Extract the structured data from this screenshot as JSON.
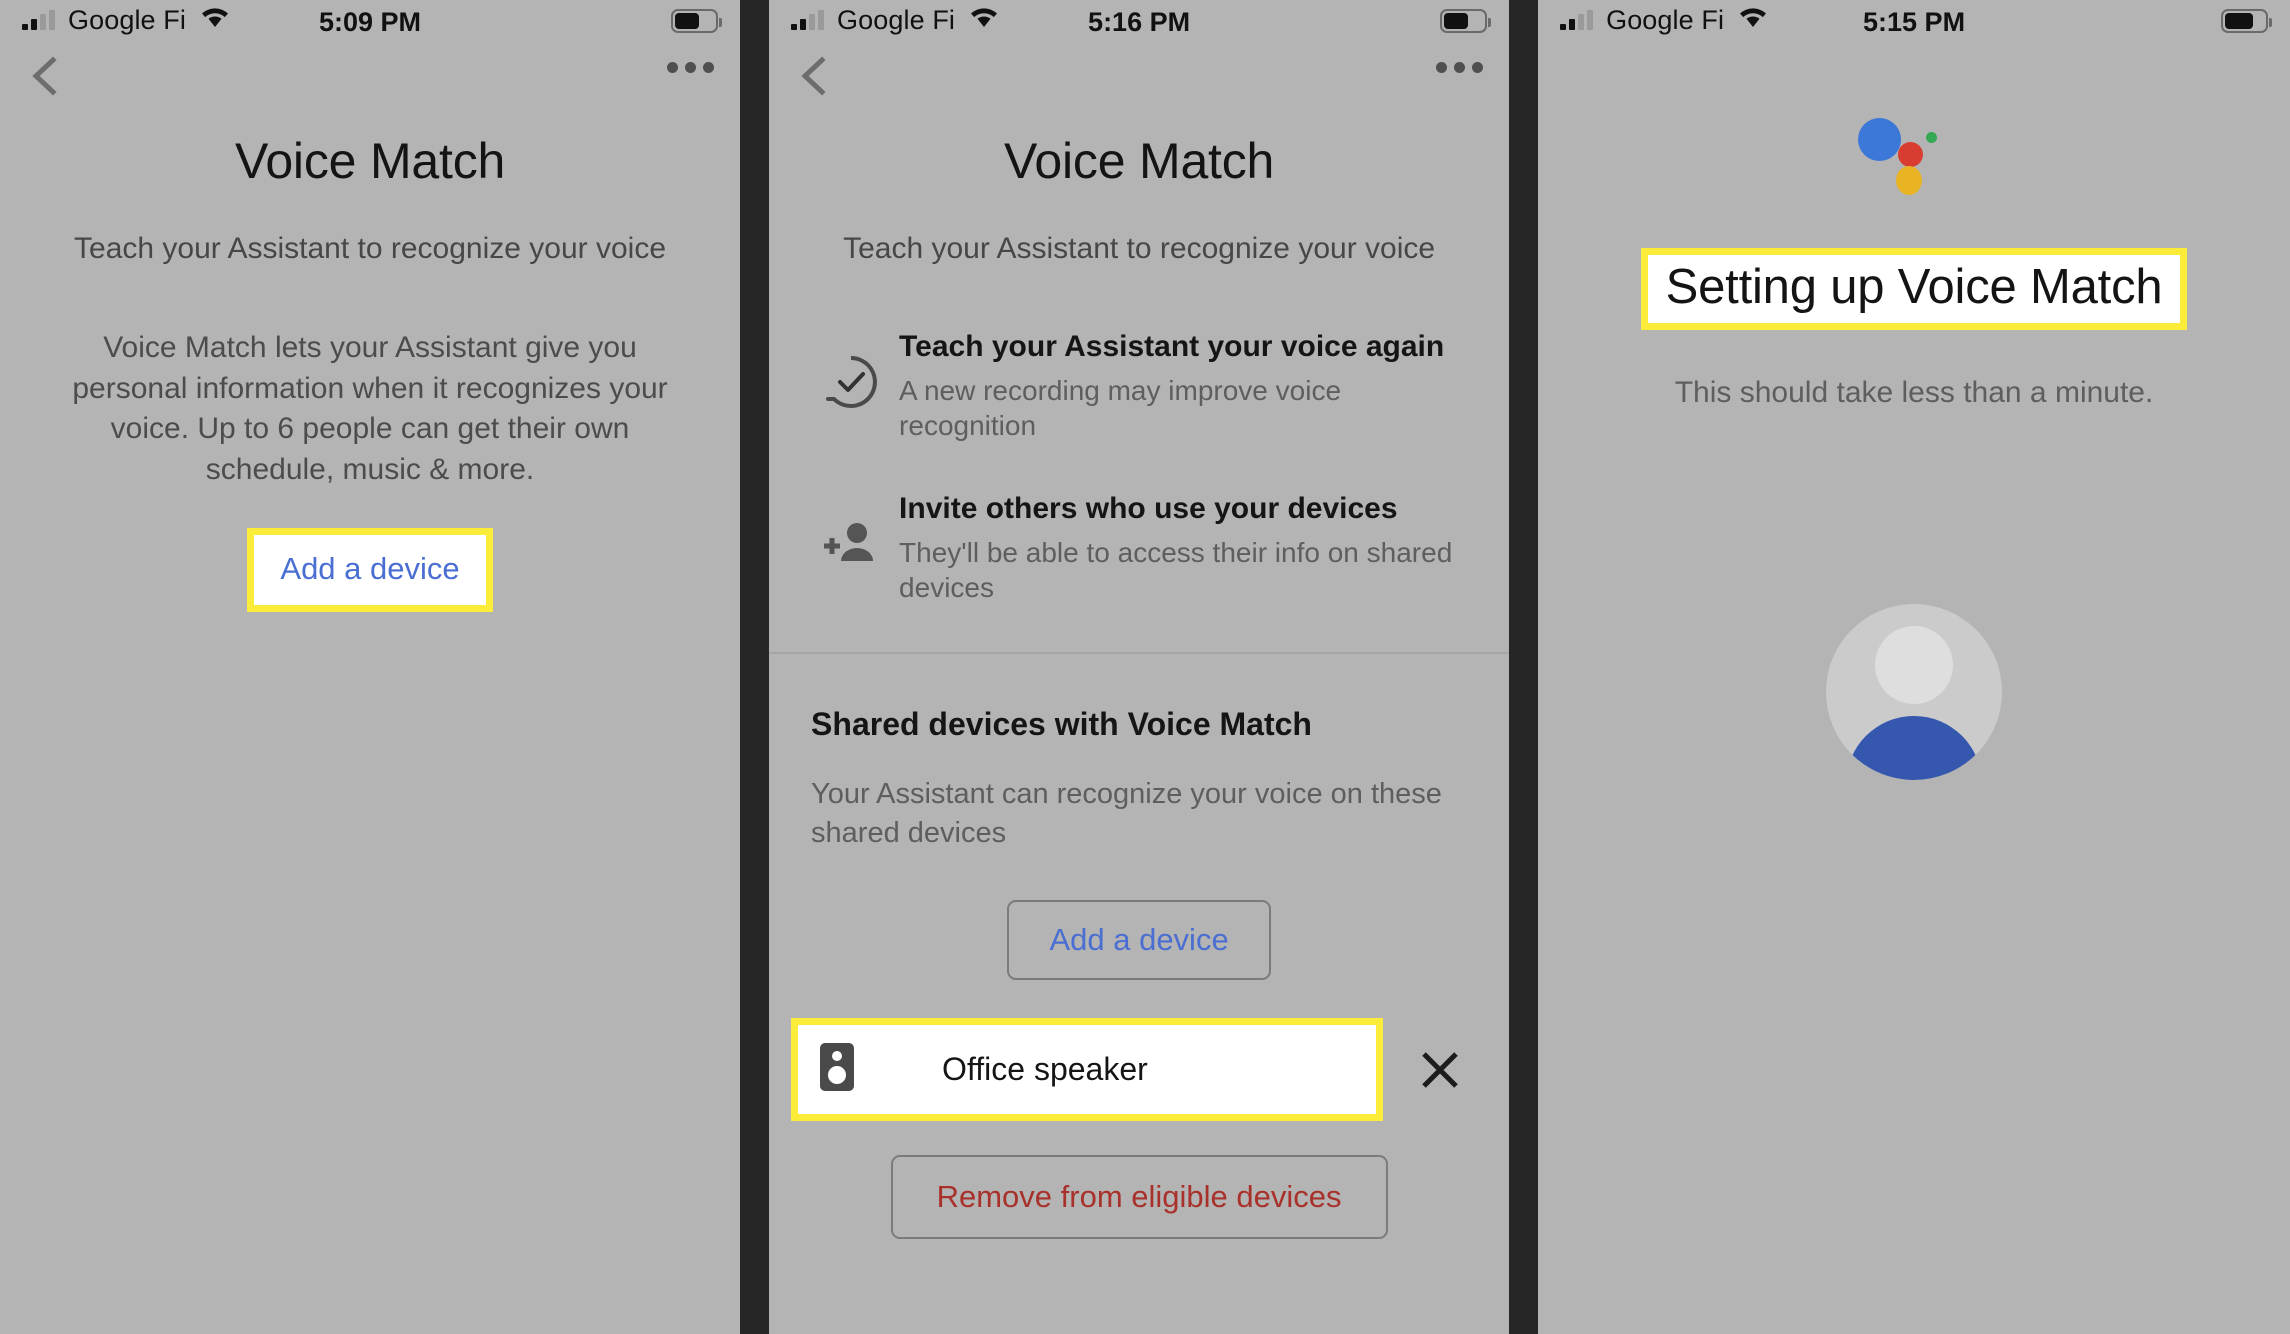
{
  "screens": [
    {
      "status": {
        "carrier": "Google Fi",
        "time": "5:09 PM"
      },
      "title": "Voice Match",
      "subtitle": "Teach your Assistant to recognize your voice",
      "body": "Voice Match lets your Assistant give you personal information when it recognizes your voice. Up to 6 people can get their own schedule, music & more.",
      "add_device_label": "Add a device"
    },
    {
      "status": {
        "carrier": "Google Fi",
        "time": "5:16 PM"
      },
      "title": "Voice Match",
      "subtitle": "Teach your Assistant to recognize your voice",
      "features": [
        {
          "icon": "check-circle-icon",
          "title": "Teach your Assistant your voice again",
          "desc": "A new recording may improve voice recognition"
        },
        {
          "icon": "person-add-icon",
          "title": "Invite others who use your devices",
          "desc": "They'll be able to access their info on shared devices"
        }
      ],
      "section_heading": "Shared devices with Voice Match",
      "section_subtext": "Your Assistant can recognize your voice on these shared devices",
      "add_device_label": "Add a device",
      "device": {
        "icon": "speaker-icon",
        "name": "Office speaker",
        "remove_icon": "close-icon"
      },
      "remove_label": "Remove from eligible devices"
    },
    {
      "status": {
        "carrier": "Google Fi",
        "time": "5:15 PM"
      },
      "heading": "Setting up Voice Match",
      "subtext": "This should take less than a minute.",
      "avatar": "user-avatar"
    }
  ],
  "colors": {
    "highlight": "#fbec3a",
    "link_blue": "#4a6ed1",
    "danger_red": "#a8322b",
    "assistant_blue": "#3c78d8",
    "assistant_red": "#d93c30",
    "assistant_yellow": "#e8b424",
    "assistant_green": "#34a853",
    "avatar_blue": "#3558ae",
    "background": "#b4b4b4"
  }
}
